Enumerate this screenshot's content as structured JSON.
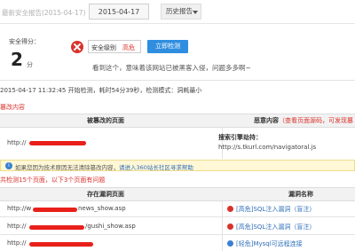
{
  "topbar": {
    "report_title": "最新安全报告(2015-04-17)",
    "date": "2015-04-17",
    "history_label": "历史报告"
  },
  "score": {
    "label": "安全得分：",
    "value": "2",
    "unit": "分"
  },
  "level": {
    "label": "安全级别",
    "value": "高危"
  },
  "detect_button": "立即检测",
  "warning": "看到这个，意味着该网站已被黑客入侵，问题多多啊~",
  "meta": "2015-04-17 11:32:45 开始检测，耗时54分39秒，检测模式：洞耗最小",
  "tampered_label": "篡改内容",
  "tamper_table": {
    "col1": "被篡改的页面",
    "col2": "恶意内容",
    "col2_link": "（查看页面源码，可发现篡",
    "row_url": "http://",
    "search_hijack_label": "搜索引擎劫持：",
    "search_hijack_url": "http://s.tkurl.com/navigatoral.js"
  },
  "note": {
    "text": "如果您因为技术原因无法清除篡改内容，",
    "link": "请进入360站长社区寻求帮助"
  },
  "found_label": "共检测15个页面，以下3个页面有问题",
  "vuln_table": {
    "col1": "存在漏洞页面",
    "col2": "漏洞名称",
    "rows": [
      {
        "url_prefix": "http://w",
        "url_suffix": "news_show.asp",
        "vuln": "[高危]SQL注入漏洞（盲注）",
        "severity": "high"
      },
      {
        "url_prefix": "http://",
        "url_suffix": "/gushi_show.asp",
        "vuln": "[高危]SQL注入漏洞（盲注）",
        "severity": "high"
      },
      {
        "url_prefix": "http://",
        "url_suffix": "",
        "vuln": "[轻危]Mysql可远程连接",
        "severity": "low"
      }
    ]
  }
}
